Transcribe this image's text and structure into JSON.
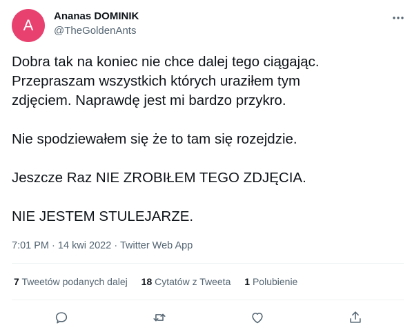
{
  "author": {
    "avatar_letter": "A",
    "avatar_color": "#e8416f",
    "display_name": "Ananas DOMINIK",
    "handle": "@TheGoldenAnts"
  },
  "tweet": {
    "paragraphs": [
      [
        "Dobra tak na koniec nie chce dalej tego ciągając.",
        "Przepraszam wszystkich których uraziłem tym",
        "zdjęciem. Naprawdę jest mi bardzo przykro."
      ],
      [
        "Nie spodziewałem się że to tam się rozejdzie."
      ],
      [
        "Jeszcze Raz NIE ZROBIŁEM TEGO ZDJĘCIA."
      ],
      [
        "NIE JESTEM STULEJARZE."
      ]
    ],
    "time": "7:01 PM",
    "separator": "·",
    "date": "14 kwi 2022",
    "source": "Twitter Web App"
  },
  "stats": {
    "retweets_count": "7",
    "retweets_label": "Tweetów podanych dalej",
    "quotes_count": "18",
    "quotes_label": "Cytatów z Tweeta",
    "likes_count": "1",
    "likes_label": "Polubienie"
  },
  "icons": {
    "more": "more-horizontal-icon",
    "reply": "reply-icon",
    "retweet": "retweet-icon",
    "like": "heart-icon",
    "share": "share-icon"
  },
  "colors": {
    "text_primary": "#0f1419",
    "text_secondary": "#536471",
    "divider": "#eff3f4"
  }
}
